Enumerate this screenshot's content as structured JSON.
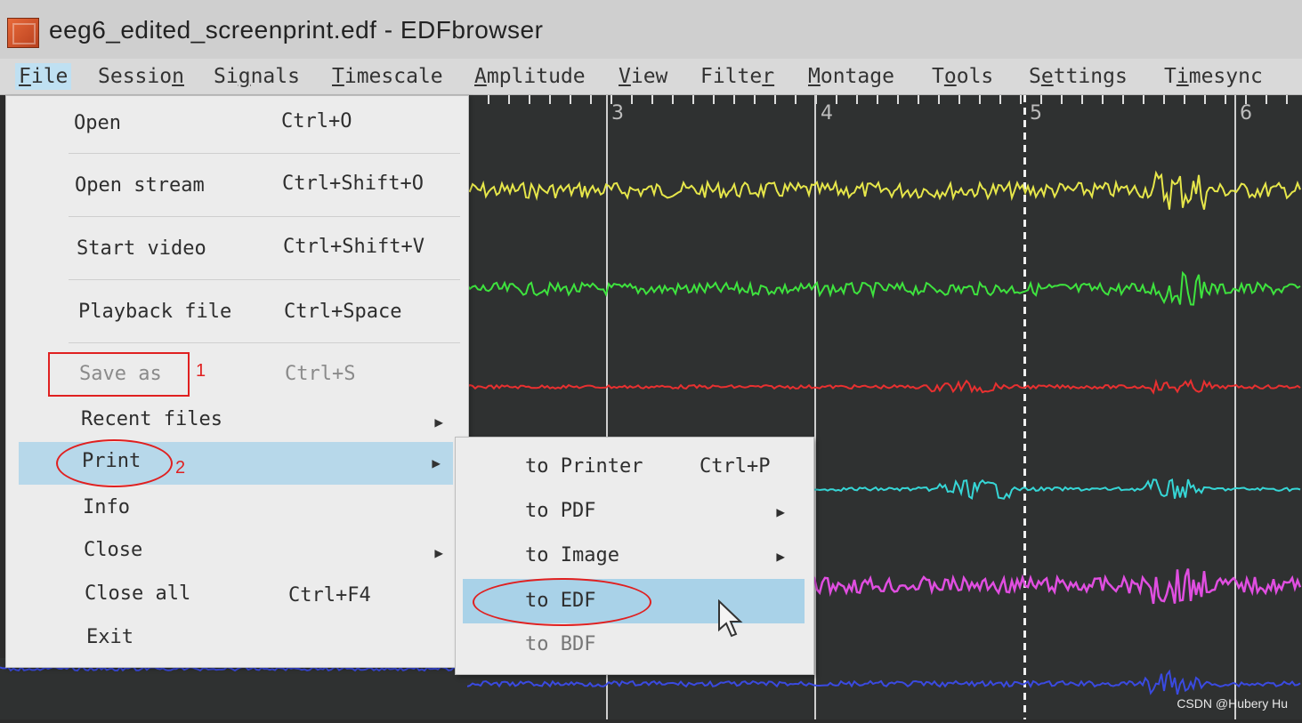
{
  "window": {
    "title": "eeg6_edited_screenprint.edf - EDFbrowser"
  },
  "menubar": {
    "items": [
      {
        "pre": "",
        "u": "F",
        "post": "ile"
      },
      {
        "pre": "Sessio",
        "u": "n",
        "post": ""
      },
      {
        "pre": "Si",
        "u": "g",
        "post": "nals"
      },
      {
        "pre": "",
        "u": "T",
        "post": "imescale"
      },
      {
        "pre": "",
        "u": "A",
        "post": "mplitude"
      },
      {
        "pre": "",
        "u": "V",
        "post": "iew"
      },
      {
        "pre": "Filte",
        "u": "r",
        "post": ""
      },
      {
        "pre": "",
        "u": "M",
        "post": "ontage"
      },
      {
        "pre": "T",
        "u": "o",
        "post": "ols"
      },
      {
        "pre": "S",
        "u": "e",
        "post": "ttings"
      },
      {
        "pre": "T",
        "u": "i",
        "post": "mesync"
      }
    ]
  },
  "file_menu": {
    "items": [
      {
        "label": "Open",
        "shortcut": "Ctrl+O"
      },
      {
        "label": "Open stream",
        "shortcut": "Ctrl+Shift+O"
      },
      {
        "label": "Start video",
        "shortcut": "Ctrl+Shift+V"
      },
      {
        "label": "Playback file",
        "shortcut": "Ctrl+Space"
      },
      {
        "label": "Save as",
        "shortcut": "Ctrl+S"
      },
      {
        "label": "Recent files",
        "shortcut": ""
      },
      {
        "label": "Print",
        "shortcut": ""
      },
      {
        "label": "Info",
        "shortcut": ""
      },
      {
        "label": "Close",
        "shortcut": ""
      },
      {
        "label": "Close all",
        "shortcut": "Ctrl+F4"
      },
      {
        "label": "Exit",
        "shortcut": ""
      }
    ]
  },
  "print_submenu": {
    "items": [
      {
        "label": "to Printer",
        "shortcut": "Ctrl+P"
      },
      {
        "label": "to PDF",
        "shortcut": ""
      },
      {
        "label": "to Image",
        "shortcut": ""
      },
      {
        "label": "to EDF",
        "shortcut": ""
      },
      {
        "label": "to BDF",
        "shortcut": ""
      }
    ]
  },
  "timescale": {
    "ticks": [
      "3",
      "4",
      "5",
      "6"
    ]
  },
  "annotations": {
    "step1": "1",
    "step2": "2"
  },
  "traces": {
    "colors": [
      "#e6e64a",
      "#3ee33e",
      "#e83030",
      "#36d6d6",
      "#e04ee0",
      "#3a4ae0"
    ]
  },
  "watermark": "CSDN @Hubery Hu"
}
